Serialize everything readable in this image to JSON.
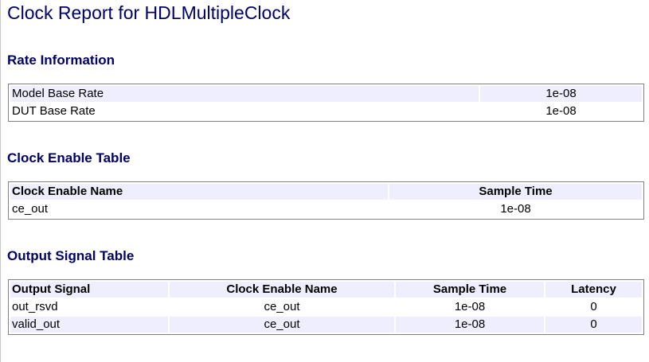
{
  "page": {
    "title": "Clock Report for HDLMultipleClock"
  },
  "rate_information": {
    "heading": "Rate Information",
    "rows": [
      {
        "label": "Model Base Rate",
        "value": "1e-08"
      },
      {
        "label": "DUT Base Rate",
        "value": "1e-08"
      }
    ]
  },
  "clock_enable_table": {
    "heading": "Clock Enable Table",
    "columns": [
      "Clock Enable Name",
      "Sample Time"
    ],
    "rows": [
      [
        "ce_out",
        "1e-08"
      ]
    ]
  },
  "output_signal_table": {
    "heading": "Output Signal Table",
    "columns": [
      "Output Signal",
      "Clock Enable Name",
      "Sample Time",
      "Latency"
    ],
    "rows": [
      [
        "out_rsvd",
        "ce_out",
        "1e-08",
        "0"
      ],
      [
        "valid_out",
        "ce_out",
        "1e-08",
        "0"
      ]
    ]
  },
  "colors": {
    "heading": "#000066",
    "row_shade": "#eeeeff",
    "table_border": "#808080"
  }
}
